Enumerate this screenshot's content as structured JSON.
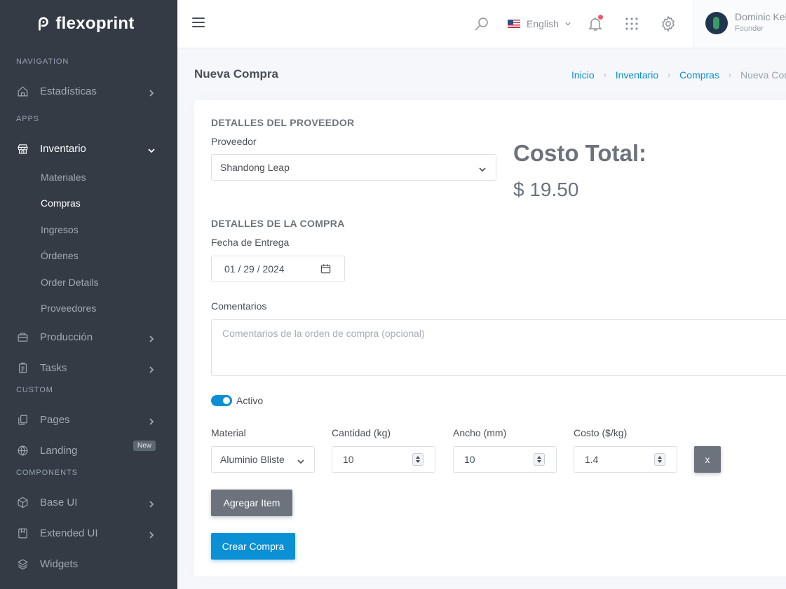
{
  "sidebar": {
    "logo": "flexoprint",
    "sections": {
      "navigation": "NAVIGATION",
      "apps": "APPS",
      "custom": "CUSTOM",
      "components": "COMPONENTS"
    },
    "items": {
      "estadisticas": "Estadísticas",
      "inventario": "Inventario",
      "produccion": "Producción",
      "tasks": "Tasks",
      "pages": "Pages",
      "landing": "Landing",
      "landing_badge": "New",
      "base_ui": "Base UI",
      "extended_ui": "Extended UI",
      "widgets": "Widgets"
    },
    "inventario_sub": [
      "Materiales",
      "Compras",
      "Ingresos",
      "Órdenes",
      "Order Details",
      "Proveedores"
    ]
  },
  "topbar": {
    "language": "English",
    "user_name": "Dominic Keller",
    "user_role": "Founder"
  },
  "page": {
    "title": "Nueva Compra",
    "breadcrumb": [
      "Inicio",
      "Inventario",
      "Compras",
      "Nueva Compra"
    ]
  },
  "form": {
    "supplier_section": "DETALLES DEL PROVEEDOR",
    "supplier_label": "Proveedor",
    "supplier_value": "Shandong Leap",
    "total_title": "Costo Total:",
    "total_value": "$ 19.50",
    "purchase_section": "DETALLES DE LA COMPRA",
    "delivery_label": "Fecha de Entrega",
    "delivery_value": "01 / 29 / 2024",
    "comments_label": "Comentarios",
    "comments_placeholder": "Comentarios de la orden de compra (opcional)",
    "active_label": "Activo",
    "active": true,
    "columns": {
      "material": "Material",
      "cantidad": "Cantidad (kg)",
      "ancho": "Ancho (mm)",
      "costo": "Costo ($/kg)"
    },
    "item": {
      "material": "Aluminio Blister",
      "cantidad": "10",
      "ancho": "10",
      "costo": "1.4",
      "remove": "x"
    },
    "add_item": "Agregar Item",
    "submit": "Crear Compra"
  },
  "colors": {
    "sidebar_bg": "#343b45",
    "primary": "#0b8fd5",
    "secondary": "#6c737d",
    "notification": "#f1556c"
  }
}
